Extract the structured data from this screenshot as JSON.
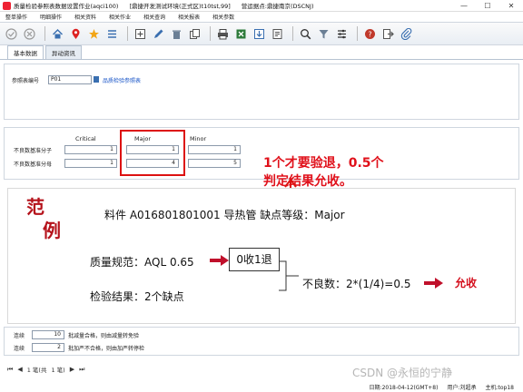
{
  "window": {
    "title_app": "质量检验参照表数据设置作业(aqci100)",
    "title_env": "[鼎捷开发测试环境(正式区)t10tst,99]",
    "title_user": "营运据点:鼎捷南京(DSCNJ)",
    "minimize": "—",
    "maximize": "☐",
    "close": "✕"
  },
  "menu": [
    "整单操作",
    "明细操作",
    "相关资料",
    "相关作业",
    "相关查询",
    "相关报表",
    "相关参数"
  ],
  "toolbar_icons": [
    "check-icon",
    "cancel-icon",
    "home-icon",
    "location-icon",
    "star-icon",
    "list-icon",
    "add-icon",
    "edit-icon",
    "delete-icon",
    "copy-icon",
    "print-icon",
    "export-icon",
    "import-icon",
    "attach-icon",
    "search-icon",
    "filter-icon",
    "settings-icon",
    "help-icon",
    "exit-icon",
    "clip-icon"
  ],
  "tabs": [
    "基本数据",
    "异动资讯"
  ],
  "form": {
    "ref_label": "参照表编号",
    "ref_value": "P01",
    "ref_link": "品质检验参照表"
  },
  "table": {
    "headers": [
      "Critical",
      "Major",
      "Minor"
    ],
    "rows": [
      {
        "label": "不良数基准分子",
        "values": [
          "1",
          "1",
          "1"
        ]
      },
      {
        "label": "不良数基准分母",
        "values": [
          "1",
          "4",
          "5"
        ]
      }
    ]
  },
  "callout": {
    "line1": "1个才要验退，0.5个",
    "line2": "判定结果允收。"
  },
  "example": {
    "fan1": "范",
    "fan2": "例",
    "part_line": "料件  A016801801001 导热管    缺点等级：Major",
    "aql_line": "质量规范：AQL 0.65",
    "aql_result": "0收1退",
    "check_line": "检验结果：2个缺点",
    "defect_line": "不良数：2*(1/4)=0.5",
    "verdict": "允收"
  },
  "bottom": {
    "row1_label": "连续",
    "row1_value": "10",
    "row1_desc": "批减量合格，则由减量转免验",
    "row2_label": "连续",
    "row2_value": "2",
    "row2_desc": "批加严不合格，则由加严转停检"
  },
  "nav": {
    "first": "⏮",
    "prev": "◀",
    "record_info": "1 笔(共",
    "total": "1 笔)",
    "next": "▶",
    "last": "⏭"
  },
  "status": {
    "date": "日期:2018-04-12(GMT+8)",
    "user": "用户:刘超承",
    "host": "主机:top18"
  },
  "watermark": "CSDN @永恒的宁静",
  "colors": {
    "accent": "#d11",
    "link": "#1a56c8"
  }
}
